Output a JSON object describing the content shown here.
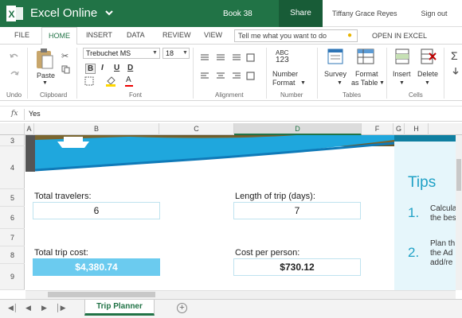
{
  "titlebar": {
    "app_name": "Excel Online",
    "book_name": "Book 38",
    "share_label": "Share",
    "user_name": "Tiffany Grace Reyes",
    "signout_label": "Sign out",
    "brand_color": "#217346"
  },
  "menu": {
    "tabs": [
      "FILE",
      "HOME",
      "INSERT",
      "DATA",
      "REVIEW",
      "VIEW"
    ],
    "active_tab": "HOME",
    "tell_me_placeholder": "Tell me what you want to do",
    "open_in_excel": "OPEN IN EXCEL"
  },
  "ribbon": {
    "groups": {
      "undo": "Undo",
      "clipboard": "Clipboard",
      "font": "Font",
      "alignment": "Alignment",
      "number": "Number",
      "tables": "Tables",
      "cells": "Cells"
    },
    "paste_label": "Paste",
    "font_name": "Trebuchet MS",
    "font_size": "18",
    "number_format_label_1": "Number",
    "number_format_label_2": "Format",
    "number_abc": "ABC",
    "number_123": "123",
    "survey_label": "Survey",
    "format_table_label_1": "Format",
    "format_table_label_2": "as Table",
    "insert_label": "Insert",
    "delete_label": "Delete",
    "bold": "B",
    "italic": "I",
    "underline": "U",
    "double_underline": "D",
    "font_color_glyph": "A"
  },
  "formula_bar": {
    "fx": "fx",
    "value": "Yes"
  },
  "grid": {
    "columns": [
      "A",
      "B",
      "C",
      "D",
      "F",
      "G",
      "H"
    ],
    "selected_column": "D",
    "rows": [
      "3",
      "4",
      "5",
      "6",
      "7",
      "8",
      "9"
    ]
  },
  "sheet": {
    "total_travelers_label": "Total travelers:",
    "total_travelers_value": "6",
    "trip_length_label": "Length of trip (days):",
    "trip_length_value": "7",
    "total_cost_label": "Total trip cost:",
    "total_cost_value": "$4,380.74",
    "cost_per_person_label": "Cost per person:",
    "cost_per_person_value": "$730.12",
    "tips_title": "Tips",
    "tips": [
      {
        "num": "1.",
        "text": "Calcula\nthe bes"
      },
      {
        "num": "2.",
        "text": "Plan th\nthe Ad\nadd/re"
      }
    ]
  },
  "sheet_tabs": {
    "active": "Trip Planner",
    "add_label": "+"
  }
}
